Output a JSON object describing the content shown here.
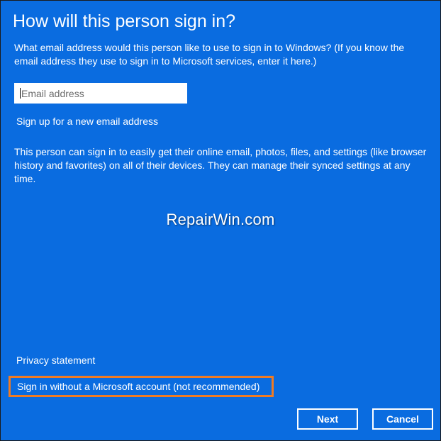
{
  "dialog": {
    "title": "How will this person sign in?",
    "prompt": "What email address would this person like to use to sign in to Windows? (If you know the email address they use to sign in to Microsoft services, enter it here.)",
    "email_input": {
      "value": "",
      "placeholder": "Email address"
    },
    "signup_link": "Sign up for a new email address",
    "info": "This person can sign in to easily get their online email, photos, files, and settings (like browser history and favorites) on all of their devices. They can manage their synced settings at any time.",
    "privacy_link": "Privacy statement",
    "no_ms_account_link": "Sign in without a Microsoft account (not recommended)",
    "buttons": {
      "next": "Next",
      "cancel": "Cancel"
    }
  },
  "watermark": "RepairWin.com",
  "colors": {
    "background": "#0a6ce0",
    "text": "#ffffff",
    "highlight_border": "#f07b22"
  }
}
